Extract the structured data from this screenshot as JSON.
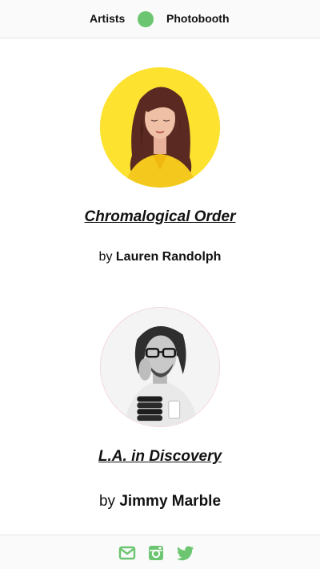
{
  "nav": {
    "artists_label": "Artists",
    "photobooth_label": "Photobooth",
    "dot_color": "#6cc570"
  },
  "artists": [
    {
      "title": "Chromalogical Order",
      "by_prefix": "by",
      "name": "Lauren Randolph",
      "avatar_bg": "#fde230"
    },
    {
      "title": "L.A. in Discovery",
      "by_prefix": "by",
      "name": "Jimmy Marble",
      "avatar_bg": "#f3f3f3"
    }
  ],
  "footer": {
    "icons": [
      "mail-icon",
      "instagram-icon",
      "twitter-icon"
    ],
    "icon_color": "#6cc570"
  }
}
